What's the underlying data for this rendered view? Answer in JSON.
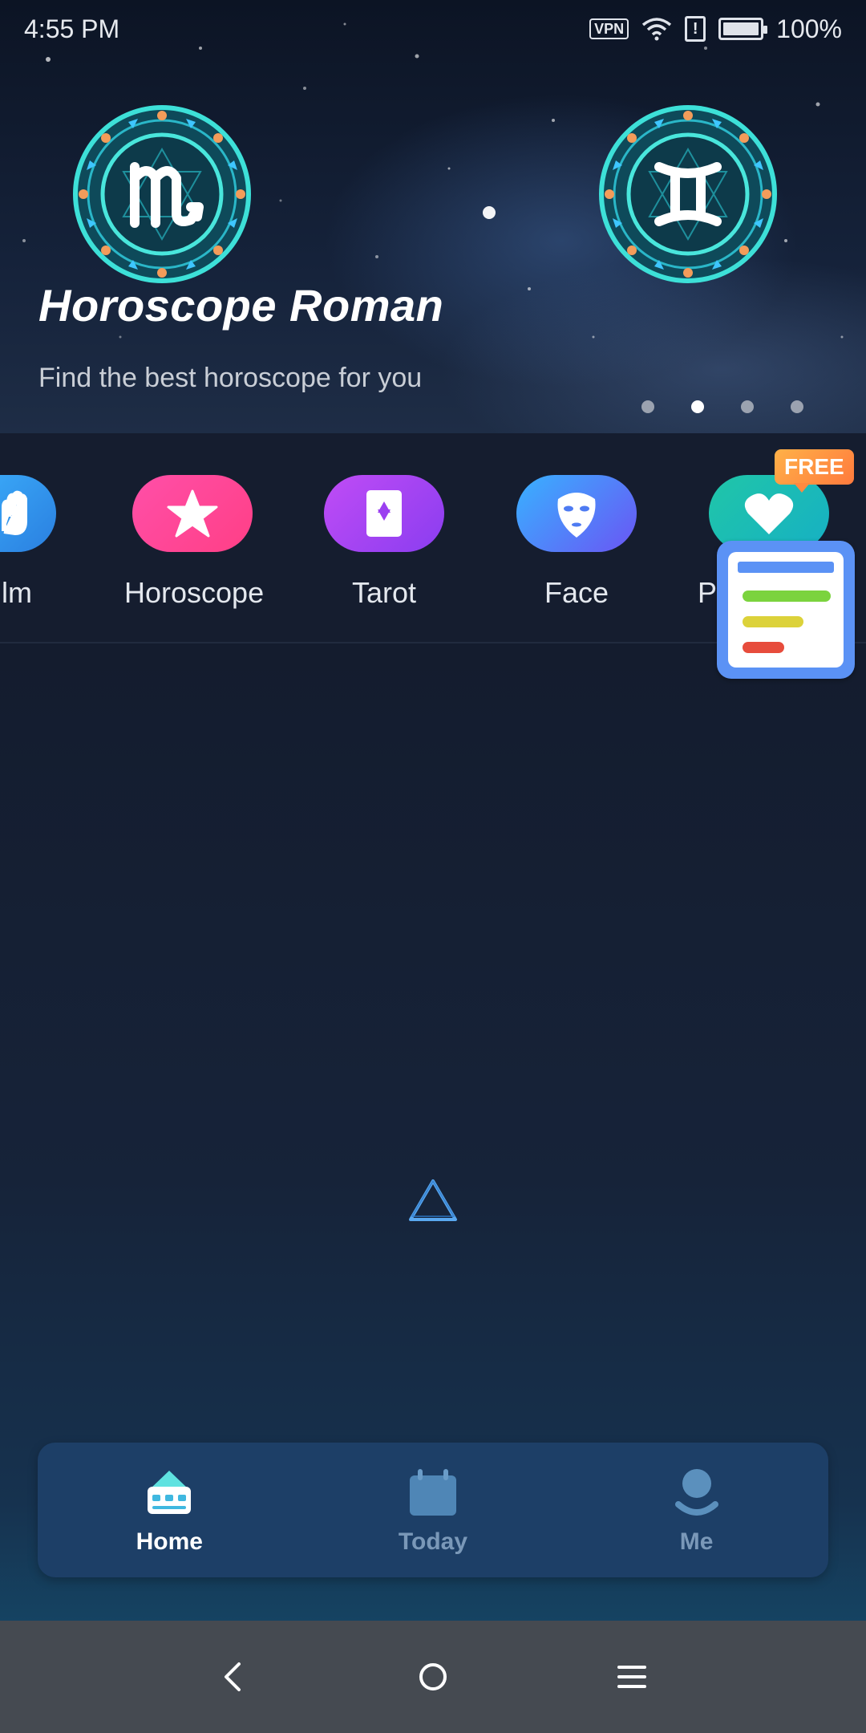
{
  "status_bar": {
    "time": "4:55 PM",
    "vpn": "VPN",
    "sim_alert": "!",
    "battery_percent": "100%",
    "battery_level": 1.0,
    "icons": [
      "vpn-icon",
      "wifi-icon",
      "sim-alert-icon",
      "battery-icon"
    ]
  },
  "banner": {
    "title": "Horoscope Roman",
    "subtitle": "Find the best horoscope for you",
    "zodiac_left": "scorpio-sign",
    "zodiac_right": "gemini-sign",
    "page_count": 4,
    "active_page": 2
  },
  "categories": {
    "items": [
      {
        "label": "lm",
        "icon": "palm-hand-icon",
        "color": "#3fb6ff"
      },
      {
        "label": "Horoscope",
        "icon": "star-icon",
        "color": "#ff4fa8"
      },
      {
        "label": "Tarot",
        "icon": "tarot-card-icon",
        "color": "#c04cf5"
      },
      {
        "label": "Face",
        "icon": "face-mask-icon",
        "color": "#38b2ff"
      },
      {
        "label": "Ps",
        "icon": "heart-icon",
        "color": "#20c6a8"
      }
    ],
    "badge": "FREE"
  },
  "tabbar": {
    "items": [
      {
        "label": "Home",
        "icon": "home-icon",
        "active": true
      },
      {
        "label": "Today",
        "icon": "calendar-icon",
        "active": false
      },
      {
        "label": "Me",
        "icon": "profile-icon",
        "active": false
      }
    ]
  },
  "system_nav": [
    "back-icon",
    "home-circle-icon",
    "menu-icon"
  ],
  "colors": {
    "background": "#141c2e",
    "tabbar": "#1d3f67",
    "tab_active": "#ffffff",
    "tab_inactive": "#7a98b8",
    "badge": "#ff8a40",
    "loader": "#5aa8f0"
  }
}
